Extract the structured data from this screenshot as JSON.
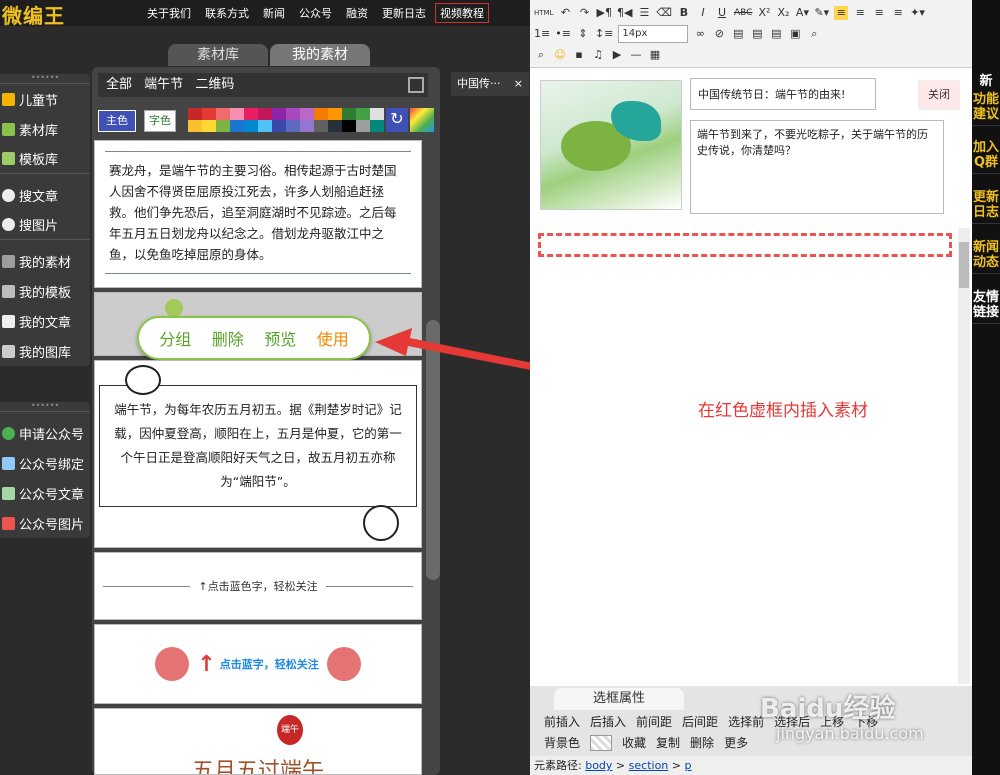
{
  "topbar": {
    "logo": "微编王",
    "nav": [
      "关于我们",
      "联系方式",
      "新闻",
      "公众号",
      "融资",
      "更新日志",
      "视频教程"
    ]
  },
  "sidebar": {
    "group1": [
      "儿童节",
      "素材库",
      "模板库"
    ],
    "group2": [
      "搜文章",
      "搜图片"
    ],
    "group3": [
      "我的素材",
      "我的模板",
      "我的文章",
      "我的图库"
    ],
    "group4": [
      "申请公众号",
      "公众号绑定",
      "公众号文章",
      "公众号图片"
    ]
  },
  "tabs": [
    "素材库",
    "我的素材"
  ],
  "filter": [
    "全部",
    "端午节",
    "二维码"
  ],
  "color_buttons": {
    "main": "主色",
    "font": "字色"
  },
  "palette": [
    "#c62828",
    "#e53935",
    "#ef6c6c",
    "#f48fb1",
    "#e91e63",
    "#c2185b",
    "#8e24aa",
    "#ab47bc",
    "#ba68c8",
    "#f57c00",
    "#ff9800",
    "#2e7d32",
    "#43a047",
    "#e0e0e0",
    "#fbc02d",
    "#fdd835",
    "#7cb342",
    "#1976d2",
    "#0288d1",
    "#4fc3f7",
    "#3949ab",
    "#5c6bc0",
    "#9575cd",
    "#616161",
    "#263238",
    "#000000",
    "#9e9e9e",
    "#00897b"
  ],
  "cards": {
    "card1": "赛龙舟，是端午节的主要习俗。相传起源于古时楚国人因舍不得贤臣屈原投江死去，许多人划船追赶拯救。他们争先恐后，追至洞庭湖时不见踪迹。之后每年五月五日划龙舟以纪念之。借划龙舟驱散江中之鱼，以免鱼吃掉屈原的身体。",
    "card3": "端午节，为每年农历五月初五。据《荆楚岁时记》记载，因仲夏登高，顺阳在上，五月是仲夏，它的第一个午日正是登高顺阳好天气之日，故五月初五亦称为“端阳节”。",
    "card4": "↑点击蓝色字，轻松关注",
    "card5": "点击蓝字，轻松关注",
    "card6_title": "五月五过端午",
    "card6_badge": "端午"
  },
  "actions": [
    "分组",
    "删除",
    "预览",
    "使用"
  ],
  "mini_tab": {
    "label": "中国传···",
    "close": "×"
  },
  "editor": {
    "font_size": "14px",
    "title": "中国传统节日：端午节的由来!",
    "close": "关闭",
    "summary": "端午节到来了，不要光吃粽子，关于端午节的历史传说，你清楚吗？",
    "hint": "在红色虚框内插入素材",
    "prop_tab": "选框属性",
    "row1": [
      "前插入",
      "后插入",
      "前间距",
      "后间距",
      "选择前",
      "选择后",
      "上移",
      "下移"
    ],
    "row2_label": "背景色",
    "row2": [
      "收藏",
      "复制",
      "删除",
      "更多"
    ],
    "path_label": "元素路径:",
    "path": [
      "body",
      "section",
      "p"
    ]
  },
  "right_strip": [
    "新",
    "功能建议",
    "加入Q群",
    "更新日志",
    "新闻动态",
    "友情链接"
  ],
  "watermark": {
    "line1": "Baidu经验",
    "line2": "jingyan.baidu.com"
  }
}
